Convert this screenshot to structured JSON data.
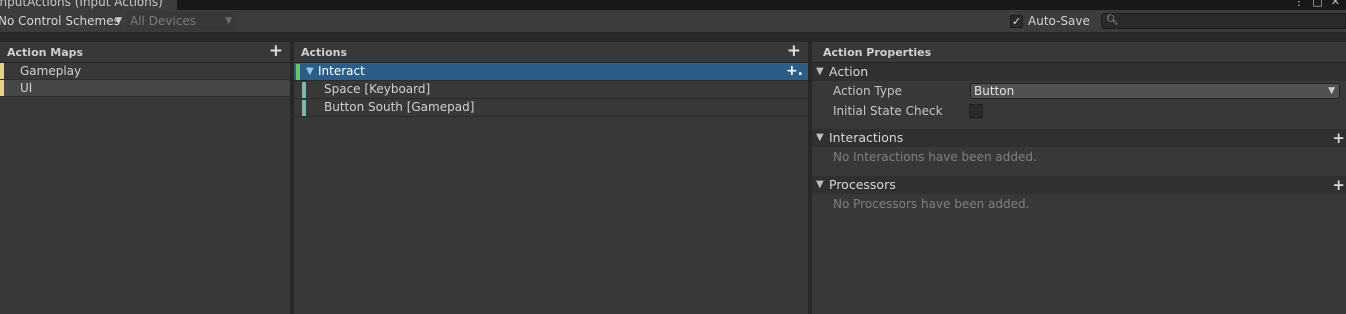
{
  "window": {
    "tab_title": "InputActions (Input Actions)",
    "icons": [
      "more-vert-icon",
      "maximize-icon",
      "close-icon"
    ]
  },
  "toolbar": {
    "control_schemes": "No Control Schemes",
    "devices": "All Devices",
    "auto_save_label": "Auto-Save",
    "auto_save_checked": true,
    "search_value": ""
  },
  "action_maps": {
    "header": "Action Maps",
    "items": [
      {
        "label": "Gameplay",
        "selected": false
      },
      {
        "label": "UI",
        "selected": true
      }
    ]
  },
  "actions": {
    "header": "Actions",
    "items": [
      {
        "label": "Interact",
        "type": "action",
        "selected": true
      },
      {
        "label": "Space [Keyboard]",
        "type": "binding"
      },
      {
        "label": "Button South [Gamepad]",
        "type": "binding"
      }
    ]
  },
  "properties": {
    "header": "Action Properties",
    "action_section": "Action",
    "action_type_label": "Action Type",
    "action_type_value": "Button",
    "initial_state_label": "Initial State Check",
    "initial_state_checked": false,
    "interactions_section": "Interactions",
    "interactions_empty": "No Interactions have been added.",
    "processors_section": "Processors",
    "processors_empty": "No Processors have been added."
  },
  "colors": {
    "action_map_accent": "#e7d37f",
    "action_accent": "#6ec36e",
    "binding_accent": "#7fb5b0",
    "selection_blue": "#2c5d87"
  }
}
